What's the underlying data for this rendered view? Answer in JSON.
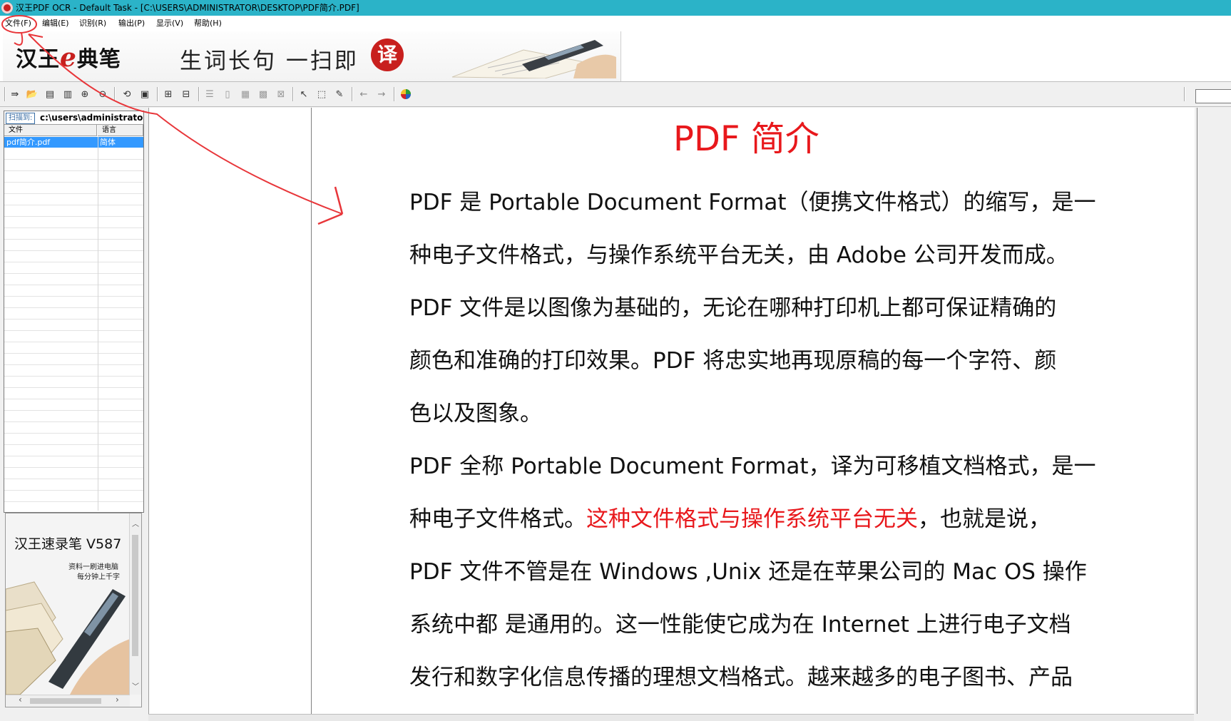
{
  "window": {
    "title": "汉王PDF OCR - Default Task - [C:\\USERS\\ADMINISTRATOR\\DESKTOP\\PDF简介.PDF]"
  },
  "menu": {
    "items": [
      {
        "label": "文件(F)",
        "name": "menu-file"
      },
      {
        "label": "编辑(E)",
        "name": "menu-edit"
      },
      {
        "label": "识别(R)",
        "name": "menu-recognize"
      },
      {
        "label": "输出(P)",
        "name": "menu-output"
      },
      {
        "label": "显示(V)",
        "name": "menu-view"
      },
      {
        "label": "帮助(H)",
        "name": "menu-help"
      }
    ]
  },
  "banner": {
    "brand_prefix": "汉王",
    "brand_e": "e",
    "brand_suffix": "典笔",
    "slogan": "生词长句  一扫即",
    "badge": "译"
  },
  "file_panel": {
    "scan_label": "扫描到:",
    "scan_path": "c:\\users\\administrator\\",
    "col_file": "文件",
    "col_lang": "语言",
    "files": [
      {
        "name": "pdf简介.pdf",
        "lang": "简体"
      }
    ]
  },
  "ad": {
    "title": "汉王速录笔  V587",
    "sub1": "资料一刷进电脑",
    "sub2": "每分钟上千字"
  },
  "document": {
    "title": "PDF 简介",
    "lines": [
      "PDF 是 Portable Document Format（便携文件格式）的缩写，是一",
      "种电子文件格式，与操作系统平台无关，由 Adobe  公司开发而成。",
      "PDF  文件是以图像为基础的，无论在哪种打印机上都可保证精确的",
      "颜色和准确的打印效果。PDF  将忠实地再现原稿的每一个字符、颜",
      "色以及图象。",
      "PDF 全称 Portable Document Format，译为可移植文档格式，是一"
    ],
    "line7_pre": "种电子文件格式。",
    "line7_red": "这种文件格式与操作系统平台无关",
    "line7_post": "，也就是说，",
    "lines_after": [
      "PDF 文件不管是在 Windows ,Unix 还是在苹果公司的 Mac OS 操作",
      "系统中都  是通用的。这一性能使它成为在  Internet 上进行电子文档",
      "发行和数字化信息传播的理想文档格式。越来越多的电子图书、产品"
    ]
  },
  "colors": {
    "titlebar": "#2bb3c8",
    "accent_red": "#e8181c",
    "selection": "#3399ff"
  }
}
